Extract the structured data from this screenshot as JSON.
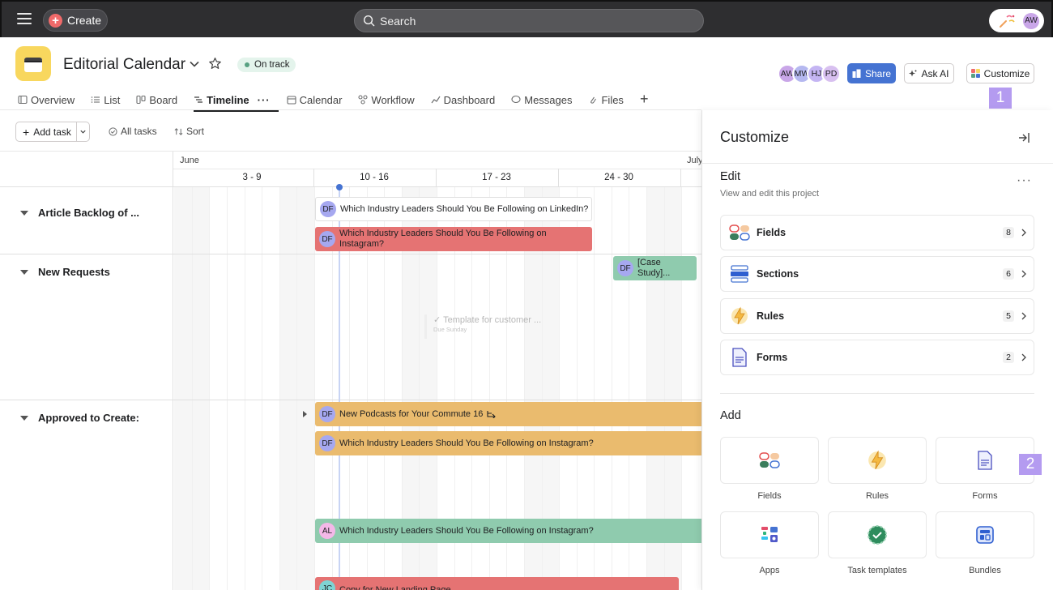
{
  "topbar": {
    "create_label": "Create",
    "search_placeholder": "Search",
    "user_initials": "AW"
  },
  "project": {
    "title": "Editorial Calendar",
    "status": "On track",
    "members": [
      "AW",
      "MW",
      "HJ",
      "PD"
    ],
    "share_label": "Share",
    "ask_ai_label": "Ask AI",
    "customize_label": "Customize",
    "icon": "calendar-icon",
    "icon_color": "#f8d75e"
  },
  "tabs": [
    {
      "label": "Overview",
      "icon": "overview-icon"
    },
    {
      "label": "List",
      "icon": "list-icon"
    },
    {
      "label": "Board",
      "icon": "board-icon"
    },
    {
      "label": "Timeline",
      "icon": "timeline-icon",
      "active": true
    },
    {
      "label": "Calendar",
      "icon": "calendar-icon"
    },
    {
      "label": "Workflow",
      "icon": "workflow-icon"
    },
    {
      "label": "Dashboard",
      "icon": "dashboard-icon"
    },
    {
      "label": "Messages",
      "icon": "messages-icon"
    },
    {
      "label": "Files",
      "icon": "paperclip-icon"
    }
  ],
  "toolbar": {
    "add_task_label": "Add task",
    "all_tasks_label": "All tasks",
    "sort_label": "Sort"
  },
  "timeline": {
    "months": [
      "June",
      "July"
    ],
    "weeks": [
      "3 - 9",
      "10 - 16",
      "17 - 23",
      "24 - 30"
    ],
    "sections": [
      {
        "name": "Article Backlog of ..."
      },
      {
        "name": "New Requests"
      },
      {
        "name": "Approved to Create:"
      }
    ],
    "tasks": [
      {
        "assignee": "DF",
        "title": "Which Industry Leaders Should You Be Following on LinkedIn?",
        "color": "#ffffff"
      },
      {
        "assignee": "DF",
        "title": "Which Industry Leaders Should You Be Following on Instagram?",
        "color": "#e57373"
      },
      {
        "assignee": "DF",
        "title": "[Case Study]...",
        "color": "#8fcbae"
      },
      {
        "assignee": "DF",
        "title": "New Podcasts for Your Commute 16",
        "color": "#eabb6e"
      },
      {
        "assignee": "DF",
        "title": "Which Industry Leaders Should You Be Following on Instagram?",
        "color": "#eabb6e"
      },
      {
        "assignee": "AL",
        "title": "Which Industry Leaders Should You Be Following on Instagram?",
        "color": "#8fcbae"
      },
      {
        "assignee": "JC",
        "title": "Copy for New Landing Page",
        "color": "#e57373"
      }
    ],
    "ghost_task": {
      "title": "Template for customer ...",
      "due": "Due Sunday"
    }
  },
  "customize_panel": {
    "title": "Customize",
    "edit": {
      "title": "Edit",
      "subtitle": "View and edit this project",
      "items": [
        {
          "label": "Fields",
          "count": "8",
          "icon": "fields-icon"
        },
        {
          "label": "Sections",
          "count": "6",
          "icon": "sections-icon"
        },
        {
          "label": "Rules",
          "count": "5",
          "icon": "rules-icon"
        },
        {
          "label": "Forms",
          "count": "2",
          "icon": "forms-icon"
        }
      ]
    },
    "add": {
      "title": "Add",
      "items": [
        {
          "label": "Fields",
          "icon": "fields-icon"
        },
        {
          "label": "Rules",
          "icon": "rules-icon"
        },
        {
          "label": "Forms",
          "icon": "forms-icon"
        },
        {
          "label": "Apps",
          "icon": "apps-icon"
        },
        {
          "label": "Task templates",
          "icon": "task-templates-icon"
        },
        {
          "label": "Bundles",
          "icon": "bundles-icon"
        }
      ]
    }
  },
  "markers": [
    "1",
    "2"
  ]
}
